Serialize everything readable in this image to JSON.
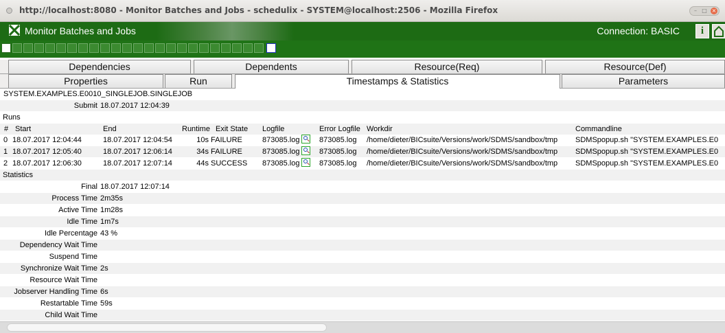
{
  "window": {
    "title": "http://localhost:8080 - Monitor Batches and Jobs - schedulix - SYSTEM@localhost:2506 - Mozilla Firefox"
  },
  "app": {
    "title": "Monitor Batches and Jobs",
    "connection": "Connection:  BASIC",
    "info_label": "i"
  },
  "tabs_row1": [
    "Dependencies",
    "Dependents",
    "Resource(Req)",
    "Resource(Def)"
  ],
  "tabs_row2": [
    "Properties",
    "Run",
    "Timestamps & Statistics",
    "Parameters"
  ],
  "active_tab": "Timestamps & Statistics",
  "job": {
    "path": "SYSTEM.EXAMPLES.E0010_SINGLEJOB.SINGLEJOB",
    "submit_label": "Submit",
    "submit_value": "18.07.2017 12:04:39"
  },
  "runs": {
    "heading": "Runs",
    "columns": [
      "#",
      "Start",
      "End",
      "Runtime",
      "Exit State",
      "Logfile",
      "Error Logfile",
      "Workdir",
      "Commandline"
    ],
    "rows": [
      {
        "n": "0",
        "start": "18.07.2017 12:04:44",
        "end": "18.07.2017 12:04:54",
        "runtime": "10s",
        "exit": "FAILURE",
        "log": "873085.log",
        "errlog": "873085.log",
        "workdir": "/home/dieter/BICsuite/Versions/work/SDMS/sandbox/tmp",
        "cmd": "SDMSpopup.sh \"SYSTEM.EXAMPLES.E0"
      },
      {
        "n": "1",
        "start": "18.07.2017 12:05:40",
        "end": "18.07.2017 12:06:14",
        "runtime": "34s",
        "exit": "FAILURE",
        "log": "873085.log",
        "errlog": "873085.log",
        "workdir": "/home/dieter/BICsuite/Versions/work/SDMS/sandbox/tmp",
        "cmd": "SDMSpopup.sh \"SYSTEM.EXAMPLES.E0"
      },
      {
        "n": "2",
        "start": "18.07.2017 12:06:30",
        "end": "18.07.2017 12:07:14",
        "runtime": "44s",
        "exit": "SUCCESS",
        "log": "873085.log",
        "errlog": "873085.log",
        "workdir": "/home/dieter/BICsuite/Versions/work/SDMS/sandbox/tmp",
        "cmd": "SDMSpopup.sh \"SYSTEM.EXAMPLES.E0"
      }
    ]
  },
  "statistics": {
    "heading": "Statistics",
    "items": [
      {
        "label": "Final",
        "value": "18.07.2017 12:07:14"
      },
      {
        "label": "Process Time",
        "value": "2m35s"
      },
      {
        "label": "Active Time",
        "value": "1m28s"
      },
      {
        "label": "Idle Time",
        "value": "1m7s"
      },
      {
        "label": "Idle Percentage",
        "value": "43 %"
      },
      {
        "label": "Dependency Wait Time",
        "value": ""
      },
      {
        "label": "Suspend Time",
        "value": ""
      },
      {
        "label": "Synchronize Wait Time",
        "value": "2s"
      },
      {
        "label": "Resource Wait Time",
        "value": ""
      },
      {
        "label": "Jobserver Handling Time",
        "value": "6s"
      },
      {
        "label": "Restartable Time",
        "value": "59s"
      },
      {
        "label": "Child Wait Time",
        "value": ""
      }
    ]
  },
  "colors": {
    "header_green": "#1d6b14",
    "toolbar_green": "#1f7316"
  }
}
